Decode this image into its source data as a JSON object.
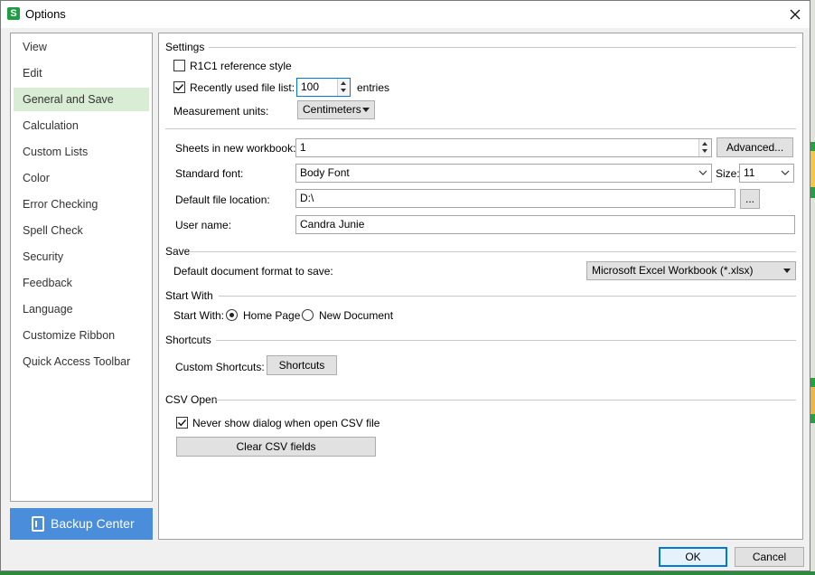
{
  "window": {
    "title": "Options",
    "app_icon": "S"
  },
  "sidebar": {
    "items": [
      {
        "label": "View"
      },
      {
        "label": "Edit"
      },
      {
        "label": "General and Save",
        "active": true
      },
      {
        "label": "Calculation"
      },
      {
        "label": "Custom Lists"
      },
      {
        "label": "Color"
      },
      {
        "label": "Error Checking"
      },
      {
        "label": "Spell Check"
      },
      {
        "label": "Security"
      },
      {
        "label": "Feedback"
      },
      {
        "label": "Language"
      },
      {
        "label": "Customize Ribbon"
      },
      {
        "label": "Quick Access Toolbar"
      }
    ],
    "backup_label": "Backup Center"
  },
  "settings": {
    "heading": "Settings",
    "r1c1_label": "R1C1 reference style",
    "r1c1_checked": false,
    "recent_label": "Recently used file list:",
    "recent_checked": true,
    "recent_value": "100",
    "recent_suffix": "entries",
    "units_label": "Measurement units:",
    "units_value": "Centimeters",
    "sheets_label": "Sheets in new workbook:",
    "sheets_value": "1",
    "advanced_label": "Advanced...",
    "font_label": "Standard font:",
    "font_value": "Body Font",
    "size_label": "Size:",
    "size_value": "11",
    "location_label": "Default file location:",
    "location_value": "D:\\",
    "browse_label": "...",
    "username_label": "User name:",
    "username_value": "Candra Junie"
  },
  "save": {
    "heading": "Save",
    "format_label": "Default document format to save:",
    "format_value": "Microsoft Excel Workbook (*.xlsx)"
  },
  "start_with": {
    "heading": "Start With",
    "label": "Start With:",
    "options": [
      {
        "label": "Home Page",
        "selected": true
      },
      {
        "label": "New Document",
        "selected": false
      }
    ]
  },
  "shortcuts": {
    "heading": "Shortcuts",
    "label": "Custom Shortcuts:",
    "button": "Shortcuts"
  },
  "csv": {
    "heading": "CSV Open",
    "never_show_label": "Never show dialog when open CSV file",
    "never_show_checked": true,
    "clear_button": "Clear CSV fields"
  },
  "footer": {
    "ok": "OK",
    "cancel": "Cancel"
  },
  "colors": {
    "accent": "#4a8ddb",
    "active_item": "#d9ecd4",
    "app_green": "#1f9d45"
  }
}
